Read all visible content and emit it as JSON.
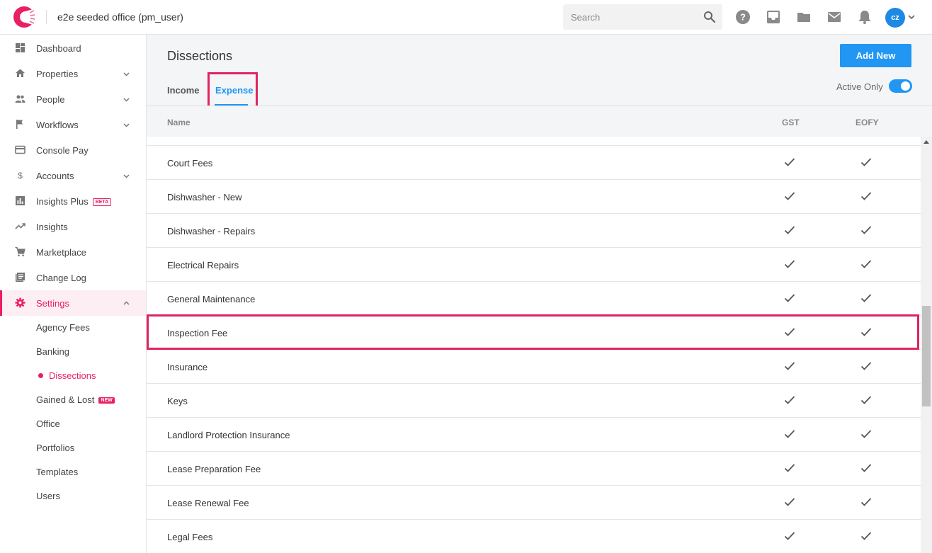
{
  "app": {
    "office_title": "e2e seeded office (pm_user)"
  },
  "search": {
    "placeholder": "Search"
  },
  "user": {
    "initials": "cz"
  },
  "sidebar": {
    "items": [
      {
        "label": "Dashboard",
        "icon": "dashboard-icon"
      },
      {
        "label": "Properties",
        "icon": "home-icon"
      },
      {
        "label": "People",
        "icon": "people-icon"
      },
      {
        "label": "Workflows",
        "icon": "flag-icon"
      },
      {
        "label": "Console Pay",
        "icon": "credit-card-icon"
      },
      {
        "label": "Accounts",
        "icon": "dollar-icon"
      },
      {
        "label": "Insights Plus",
        "icon": "bar-chart-icon",
        "badge": "BETA"
      },
      {
        "label": "Insights",
        "icon": "trending-up-icon"
      },
      {
        "label": "Marketplace",
        "icon": "cart-icon"
      },
      {
        "label": "Change Log",
        "icon": "log-icon"
      },
      {
        "label": "Settings",
        "icon": "gear-icon"
      }
    ],
    "settings_sub": [
      {
        "label": "Agency Fees"
      },
      {
        "label": "Banking"
      },
      {
        "label": "Dissections"
      },
      {
        "label": "Gained & Lost",
        "badge": "NEW"
      },
      {
        "label": "Office"
      },
      {
        "label": "Portfolios"
      },
      {
        "label": "Templates"
      },
      {
        "label": "Users"
      }
    ]
  },
  "page": {
    "title": "Dissections",
    "add_new_label": "Add New",
    "tabs": [
      {
        "label": "Income"
      },
      {
        "label": "Expense"
      }
    ],
    "active_tab": "Expense",
    "active_only_label": "Active Only",
    "active_only_on": true
  },
  "table": {
    "headers": {
      "name": "Name",
      "gst": "GST",
      "eofy": "EOFY"
    },
    "rows": [
      {
        "name": "Court Fees",
        "gst": true,
        "eofy": true
      },
      {
        "name": "Dishwasher - New",
        "gst": true,
        "eofy": true
      },
      {
        "name": "Dishwasher - Repairs",
        "gst": true,
        "eofy": true
      },
      {
        "name": "Electrical Repairs",
        "gst": true,
        "eofy": true
      },
      {
        "name": "General Maintenance",
        "gst": true,
        "eofy": true
      },
      {
        "name": "Inspection Fee",
        "gst": true,
        "eofy": true
      },
      {
        "name": "Insurance",
        "gst": true,
        "eofy": true
      },
      {
        "name": "Keys",
        "gst": true,
        "eofy": true
      },
      {
        "name": "Landlord Protection Insurance",
        "gst": true,
        "eofy": true
      },
      {
        "name": "Lease Preparation Fee",
        "gst": true,
        "eofy": true
      },
      {
        "name": "Lease Renewal Fee",
        "gst": true,
        "eofy": true
      },
      {
        "name": "Legal Fees",
        "gst": true,
        "eofy": true
      }
    ]
  },
  "colors": {
    "brand": "#e91e63",
    "accent": "#2196f3",
    "highlight_border": "#e0245e"
  }
}
